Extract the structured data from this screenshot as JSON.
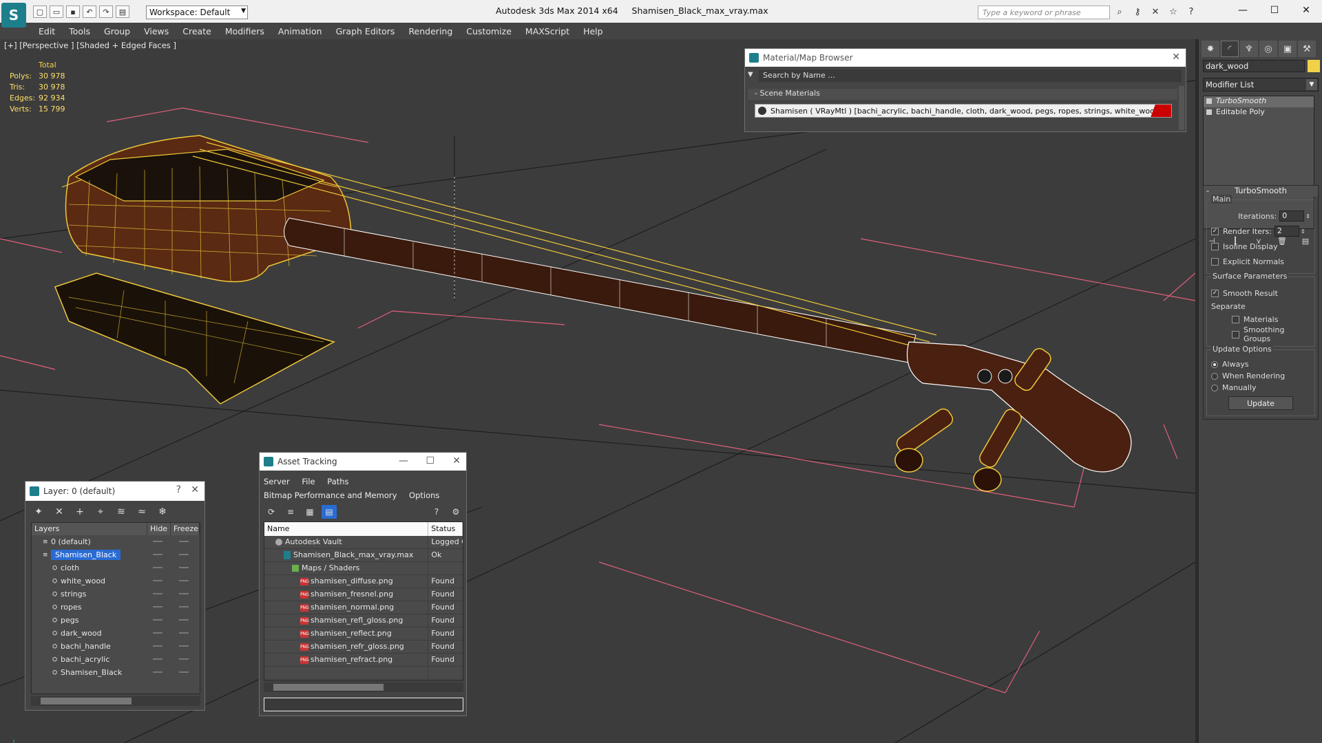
{
  "titlebar": {
    "workspace": "Workspace: Default",
    "app_title": "Autodesk 3ds Max  2014 x64",
    "file_name": "Shamisen_Black_max_vray.max",
    "search_placeholder": "Type a keyword or phrase"
  },
  "menu": [
    "Edit",
    "Tools",
    "Group",
    "Views",
    "Create",
    "Modifiers",
    "Animation",
    "Graph Editors",
    "Rendering",
    "Customize",
    "MAXScript",
    "Help"
  ],
  "viewport": {
    "label": "[+] [Perspective ] [Shaded + Edged Faces ]",
    "stats": {
      "header": "Total",
      "rows": [
        {
          "k": "Polys:",
          "v": "30 978"
        },
        {
          "k": "Tris:",
          "v": "30 978"
        },
        {
          "k": "Edges:",
          "v": "92 934"
        },
        {
          "k": "Verts:",
          "v": "15 799"
        }
      ]
    }
  },
  "material_browser": {
    "title": "Material/Map Browser",
    "search": "Search by Name ...",
    "section": "Scene Materials",
    "material": "Shamisen  ( VRayMtl ) [bachi_acrylic, bachi_handle, cloth, dark_wood, pegs, ropes, strings, white_wood]"
  },
  "command_panel": {
    "object_name": "dark_wood",
    "modifier_list": "Modifier List",
    "stack": [
      "TurboSmooth",
      "Editable Poly"
    ],
    "rollout_title": "TurboSmooth",
    "main_label": "Main",
    "iterations_label": "Iterations:",
    "iterations_value": "0",
    "render_iters_label": "Render Iters:",
    "render_iters_value": "2",
    "isoline": "Isoline Display",
    "explicit_normals": "Explicit Normals",
    "surface_params": "Surface Parameters",
    "smooth_result": "Smooth Result",
    "separate": "Separate",
    "materials": "Materials",
    "smoothing_groups": "Smoothing Groups",
    "update_options": "Update Options",
    "always": "Always",
    "when_rendering": "When Rendering",
    "manually": "Manually",
    "update_button": "Update",
    "swatch_color": "#f2d14a"
  },
  "layer_window": {
    "title": "Layer: 0 (default)",
    "col_layers": "Layers",
    "col_hide": "Hide",
    "col_freeze": "Freeze",
    "rows": [
      {
        "name": "0 (default)",
        "indent": 1
      },
      {
        "name": "Shamisen_Black",
        "indent": 1,
        "selected": true
      },
      {
        "name": "cloth",
        "indent": 2
      },
      {
        "name": "white_wood",
        "indent": 2
      },
      {
        "name": "strings",
        "indent": 2
      },
      {
        "name": "ropes",
        "indent": 2
      },
      {
        "name": "pegs",
        "indent": 2
      },
      {
        "name": "dark_wood",
        "indent": 2
      },
      {
        "name": "bachi_handle",
        "indent": 2
      },
      {
        "name": "bachi_acrylic",
        "indent": 2
      },
      {
        "name": "Shamisen_Black",
        "indent": 2
      }
    ]
  },
  "asset_window": {
    "title": "Asset Tracking",
    "menus1": [
      "Server",
      "File",
      "Paths"
    ],
    "menus2": [
      "Bitmap Performance and Memory",
      "Options"
    ],
    "col_name": "Name",
    "col_status": "Status",
    "rows": [
      {
        "name": "Autodesk Vault",
        "status": "Logged O",
        "type": "vault",
        "indent": 1
      },
      {
        "name": "Shamisen_Black_max_vray.max",
        "status": "Ok",
        "type": "file",
        "indent": 2
      },
      {
        "name": "Maps / Shaders",
        "status": "",
        "type": "folder",
        "indent": 3
      },
      {
        "name": "shamisen_diffuse.png",
        "status": "Found",
        "type": "png",
        "indent": 4
      },
      {
        "name": "shamisen_fresnel.png",
        "status": "Found",
        "type": "png",
        "indent": 4
      },
      {
        "name": "shamisen_normal.png",
        "status": "Found",
        "type": "png",
        "indent": 4
      },
      {
        "name": "shamisen_refl_gloss.png",
        "status": "Found",
        "type": "png",
        "indent": 4
      },
      {
        "name": "shamisen_reflect.png",
        "status": "Found",
        "type": "png",
        "indent": 4
      },
      {
        "name": "shamisen_refr_gloss.png",
        "status": "Found",
        "type": "png",
        "indent": 4
      },
      {
        "name": "shamisen_refract.png",
        "status": "Found",
        "type": "png",
        "indent": 4
      }
    ]
  }
}
